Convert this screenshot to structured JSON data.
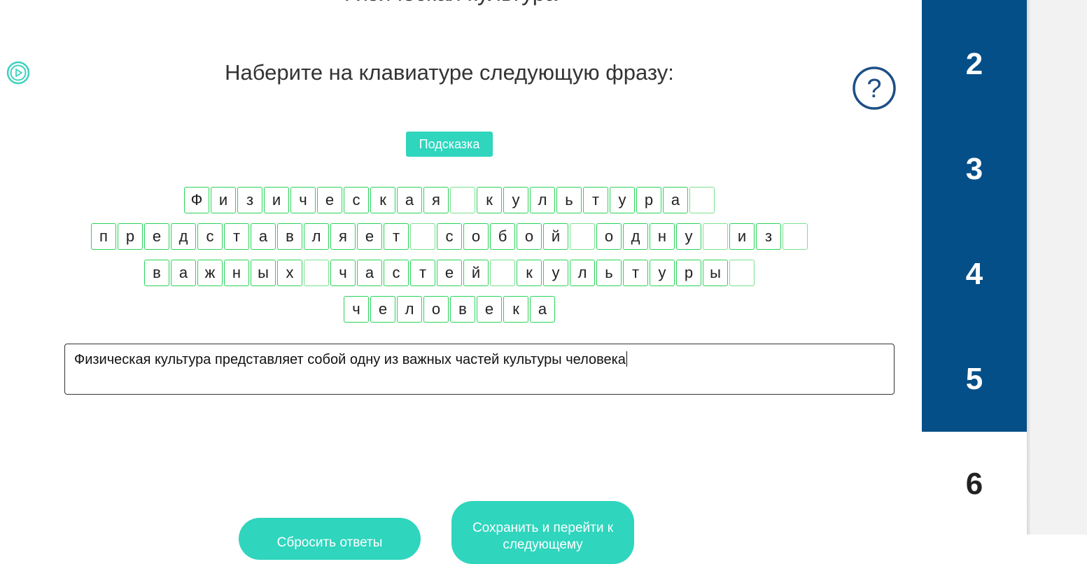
{
  "page": {
    "title": "Физическая культура",
    "instruction": "Наберите на клавиатуре следующую фразу:",
    "hint_label": "Подсказка"
  },
  "phrase": {
    "lines": [
      [
        "Ф",
        "и",
        "з",
        "и",
        "ч",
        "е",
        "с",
        "к",
        "а",
        "я",
        " ",
        "к",
        "у",
        "л",
        "ь",
        "т",
        "у",
        "р",
        "а",
        " "
      ],
      [
        "п",
        "р",
        "е",
        "д",
        "с",
        "т",
        "а",
        "в",
        "л",
        "я",
        "е",
        "т",
        " ",
        "с",
        "о",
        "б",
        "о",
        "й",
        " ",
        "о",
        "д",
        "н",
        "у",
        " ",
        "и",
        "з",
        " "
      ],
      [
        "в",
        "а",
        "ж",
        "н",
        "ы",
        "х",
        " ",
        "ч",
        "а",
        "с",
        "т",
        "е",
        "й",
        " ",
        "к",
        "у",
        "л",
        "ь",
        "т",
        "у",
        "р",
        "ы",
        " "
      ],
      [
        "ч",
        "е",
        "л",
        "о",
        "в",
        "е",
        "к",
        "а"
      ]
    ]
  },
  "answer": {
    "value": "Физическая культура представляет собой одну из важных частей культуры человека"
  },
  "buttons": {
    "reset_label": "Сбросить ответы",
    "save_label": "Сохранить и перейти к следующему"
  },
  "nav": {
    "items": [
      {
        "label": "2",
        "state": "visited"
      },
      {
        "label": "3",
        "state": "visited"
      },
      {
        "label": "4",
        "state": "visited"
      },
      {
        "label": "5",
        "state": "visited"
      },
      {
        "label": "6",
        "state": "current"
      }
    ]
  },
  "colors": {
    "accent": "#2fd5bd",
    "nav_active": "#054f88",
    "cell_border": "#29d458",
    "help_icon": "#1d4f85",
    "play_icon": "#3fd1bf"
  },
  "icons": {
    "play": "play-circle-icon",
    "help": "question-circle-icon"
  }
}
